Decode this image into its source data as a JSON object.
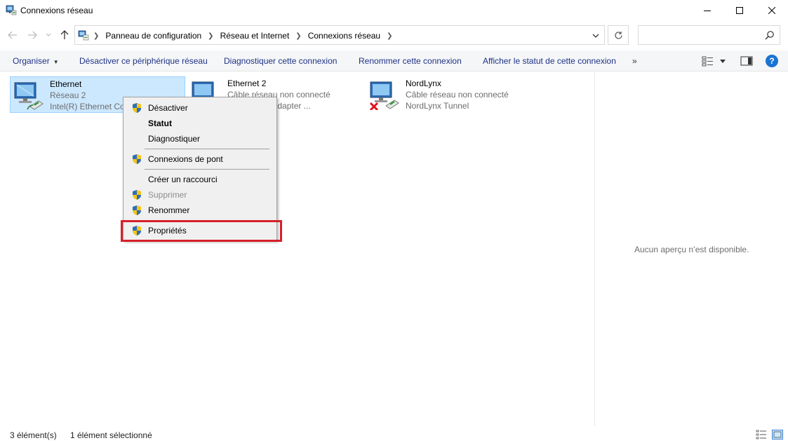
{
  "window": {
    "title": "Connexions réseau"
  },
  "address": {
    "crumbs": [
      "Panneau de configuration",
      "Réseau et Internet",
      "Connexions réseau"
    ],
    "search_placeholder": ""
  },
  "toolbar": {
    "organiser": "Organiser",
    "disable": "Désactiver ce périphérique réseau",
    "diagnose": "Diagnostiquer cette connexion",
    "rename": "Renommer cette connexion",
    "status": "Afficher le statut de cette connexion",
    "more": "»"
  },
  "items": [
    {
      "name": "Ethernet",
      "status": "Réseau 2",
      "device": "Intel(R) Ethernet Co",
      "selected": true
    },
    {
      "name": "Ethernet 2",
      "status": "Câble réseau non connecté",
      "device": "N Windows Adapter ..."
    },
    {
      "name": "NordLynx",
      "status": "Câble réseau non connecté",
      "device": "NordLynx Tunnel"
    }
  ],
  "context_menu": {
    "items": [
      {
        "label": "Désactiver"
      },
      {
        "label": "Statut"
      },
      {
        "label": "Diagnostiquer"
      },
      {
        "label": "Connexions de pont"
      },
      {
        "label": "Créer un raccourci"
      },
      {
        "label": "Supprimer"
      },
      {
        "label": "Renommer"
      },
      {
        "label": "Propriétés"
      }
    ]
  },
  "preview": {
    "message": "Aucun aperçu n’est disponible."
  },
  "statusbar": {
    "count": "3 élément(s)",
    "selected": "1 élément sélectionné"
  },
  "colors": {
    "selection": "#cce8ff",
    "link": "#1e3287",
    "highlight": "#d8202a",
    "help": "#1a73d1"
  }
}
